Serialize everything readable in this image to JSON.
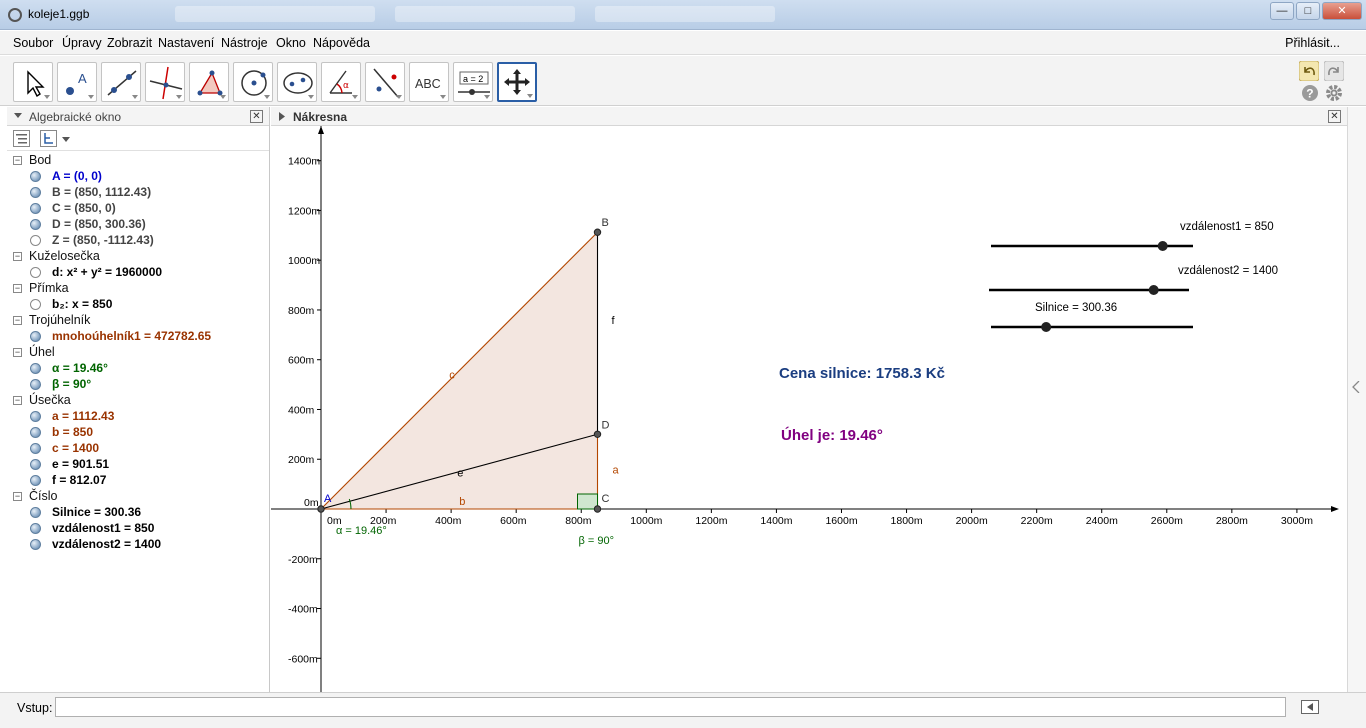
{
  "window": {
    "title": "koleje1.ggb",
    "minimize": "—",
    "maximize": "□",
    "close": "✕"
  },
  "menu": [
    "Soubor",
    "Úpravy",
    "Zobrazit",
    "Nastavení",
    "Nástroje",
    "Okno",
    "Nápověda"
  ],
  "login": "Přihlásit...",
  "tools": [
    {
      "name": "move-tool-icon"
    },
    {
      "name": "point-tool-icon"
    },
    {
      "name": "line-tool-icon"
    },
    {
      "name": "perpendicular-tool-icon"
    },
    {
      "name": "polygon-tool-icon"
    },
    {
      "name": "circle-tool-icon"
    },
    {
      "name": "ellipse-tool-icon"
    },
    {
      "name": "angle-tool-icon"
    },
    {
      "name": "reflect-tool-icon"
    },
    {
      "name": "text-tool-icon",
      "label": "ABC"
    },
    {
      "name": "slider-tool-icon",
      "label": "a = 2"
    },
    {
      "name": "move-graphics-tool-icon"
    }
  ],
  "algebra": {
    "title": "Algebraické okno",
    "categories": [
      {
        "label": "Bod",
        "items": [
          {
            "text": "A = (0, 0)",
            "color": "#0000cc",
            "visible": true
          },
          {
            "text": "B = (850, 1112.43)",
            "color": "#444444",
            "visible": true
          },
          {
            "text": "C = (850, 0)",
            "color": "#444444",
            "visible": true
          },
          {
            "text": "D = (850, 300.36)",
            "color": "#444444",
            "visible": true
          },
          {
            "text": "Z = (850, -1112.43)",
            "color": "#444444",
            "visible": false
          }
        ]
      },
      {
        "label": "Kuželosečka",
        "items": [
          {
            "text": "d: x² + y² = 1960000",
            "color": "#000000",
            "visible": false
          }
        ]
      },
      {
        "label": "Přímka",
        "items": [
          {
            "text": "b₂: x = 850",
            "color": "#000000",
            "visible": false
          }
        ]
      },
      {
        "label": "Trojúhelník",
        "items": [
          {
            "text": "mnohoúhelník1 = 472782.65",
            "color": "#993300",
            "visible": true
          }
        ]
      },
      {
        "label": "Úhel",
        "items": [
          {
            "text": "α = 19.46°",
            "color": "#006400",
            "visible": true
          },
          {
            "text": "β = 90°",
            "color": "#006400",
            "visible": true
          }
        ]
      },
      {
        "label": "Úsečka",
        "items": [
          {
            "text": "a = 1112.43",
            "color": "#993300",
            "visible": true
          },
          {
            "text": "b = 850",
            "color": "#993300",
            "visible": true
          },
          {
            "text": "c = 1400",
            "color": "#993300",
            "visible": true
          },
          {
            "text": "e = 901.51",
            "color": "#000000",
            "visible": true
          },
          {
            "text": "f = 812.07",
            "color": "#000000",
            "visible": true
          }
        ]
      },
      {
        "label": "Číslo",
        "items": [
          {
            "text": "Silnice = 300.36",
            "color": "#000000",
            "visible": true
          },
          {
            "text": "vzdálenost1 = 850",
            "color": "#000000",
            "visible": true
          },
          {
            "text": "vzdálenost2 = 1400",
            "color": "#000000",
            "visible": true
          }
        ]
      }
    ]
  },
  "graphics": {
    "title": "Nákresna",
    "xticks": [
      "0m",
      "200m",
      "400m",
      "600m",
      "800m",
      "1000m",
      "1200m",
      "1400m",
      "1600m",
      "1800m",
      "2000m",
      "2200m",
      "2400m",
      "2600m",
      "2800m",
      "3000m"
    ],
    "yticks_pos": [
      "200m",
      "400m",
      "600m",
      "800m",
      "1000m",
      "1200m",
      "1400m"
    ],
    "yticks_neg": [
      "-200m",
      "-400m",
      "-600m"
    ],
    "y0_label": "0m",
    "points": {
      "A": [
        0,
        0
      ],
      "B": [
        850,
        1112.43
      ],
      "C": [
        850,
        0
      ],
      "D": [
        850,
        300.36
      ]
    },
    "point_labels": {
      "A": "A",
      "B": "B",
      "C": "C",
      "D": "D"
    },
    "segment_labels": {
      "a": "a",
      "b": "b",
      "c": "c",
      "e": "e",
      "f": "f"
    },
    "angle_alpha": "α = 19.46°",
    "angle_beta": "β = 90°",
    "sliders": [
      {
        "label": "vzdálenost1 = 850",
        "value": 850,
        "min": 0,
        "max": 1000
      },
      {
        "label": "vzdálenost2 = 1400",
        "value": 1400,
        "min": 0,
        "max": 1700
      },
      {
        "label": "Silnice = 300.36",
        "value": 300.36,
        "min": 0,
        "max": 1100
      }
    ],
    "price_text": "Cena silnice: 1758.3 Kč",
    "angle_text": "Úhel je: 19.46°",
    "colors": {
      "triangle_fill": "#f3e6e0",
      "triangle_edge": "#b34700",
      "price": "#1a3d80",
      "angle": "#800080",
      "angle_label": "#006400"
    }
  },
  "input": {
    "label": "Vstup:",
    "value": ""
  }
}
